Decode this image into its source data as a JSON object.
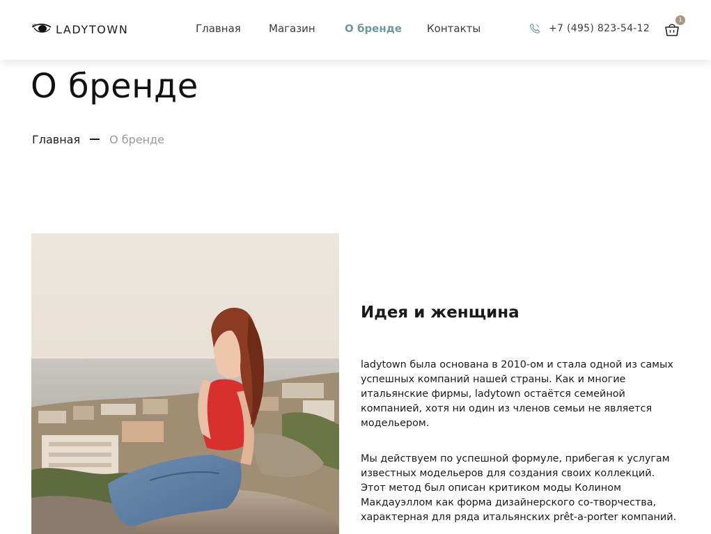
{
  "header": {
    "logo_text": "LADYTOWN",
    "nav": [
      {
        "label": "Главная",
        "active": false
      },
      {
        "label": "Магазин",
        "active": false
      },
      {
        "label": "О бренде",
        "active": true
      },
      {
        "label": "Контакты",
        "active": false
      }
    ],
    "phone": "+7 (495) 823-54-12",
    "phone_icon": "phone-icon",
    "cart_icon": "basket-icon",
    "cart_count": "1"
  },
  "page": {
    "title": "О бренде",
    "breadcrumb": {
      "home": "Главная",
      "current": "О бренде"
    }
  },
  "about": {
    "heading": "Идея и женщина",
    "paragraphs": [
      "ladytown была основана в 2010-ом и стала одной из самых успешных компаний нашей страны. Как и многие итальянские фирмы, ladytown остаётся семейной компанией, хотя ни один из членов семьи не является модельером.",
      "Мы действуем по успешной формуле, прибегая к услугам известных модельеров для создания своих коллекций. Этот метод был описан критиком моды Колином Макдауэллом как форма дизайнерского со-творчества, характерная для ряда итальянских prêt-a-porter компаний."
    ]
  },
  "colors": {
    "accent": "#6f9a9a",
    "badge": "#a39a86",
    "text": "#1a1a1a",
    "muted": "#9a9a9a"
  }
}
